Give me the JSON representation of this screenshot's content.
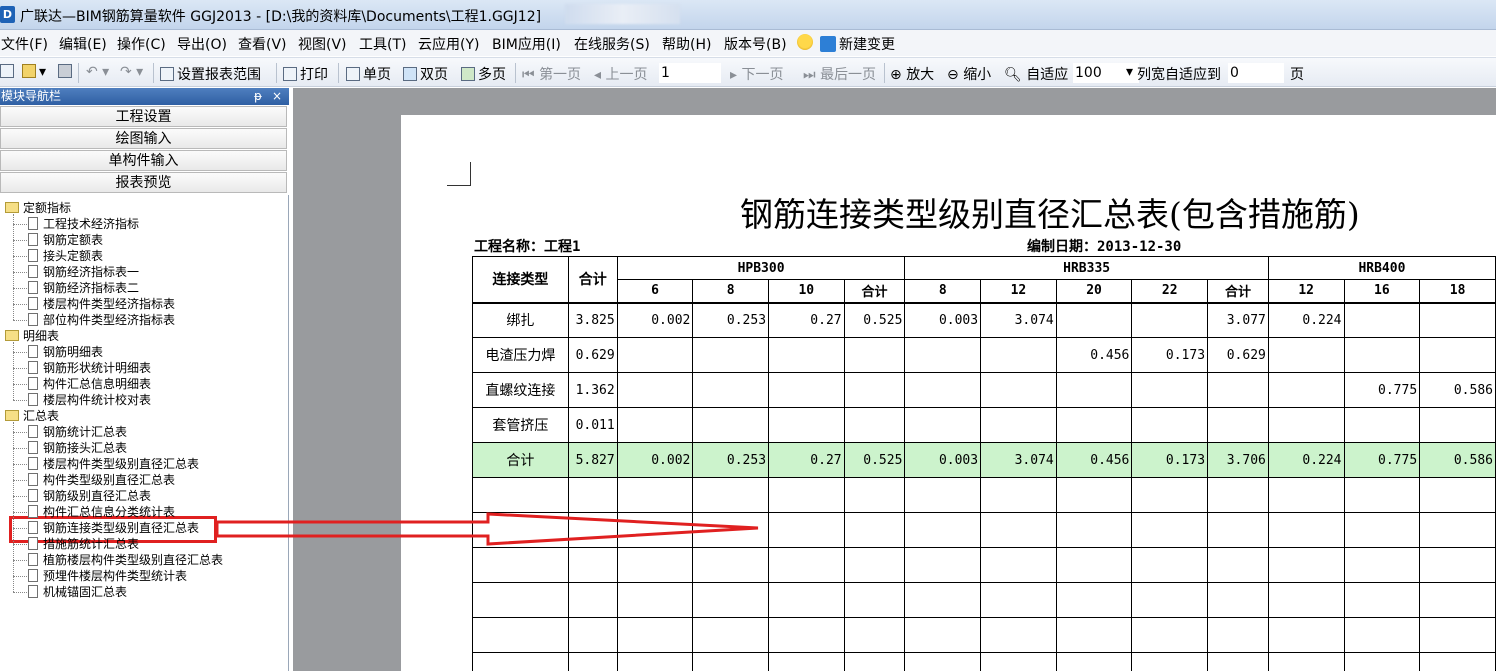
{
  "window": {
    "app_icon": "D",
    "title": "广联达—BIM钢筋算量软件 GGJ2013 - [D:\\我的资料库\\Documents\\工程1.GGJ12]"
  },
  "menu": {
    "items": [
      "文件(F)",
      "编辑(E)",
      "操作(C)",
      "导出(O)",
      "查看(V)",
      "视图(V)",
      "工具(T)",
      "云应用(Y)",
      "BIM应用(I)",
      "在线服务(S)",
      "帮助(H)",
      "版本号(B)"
    ],
    "new_change": "新建变更"
  },
  "toolbar": {
    "set_range": "设置报表范围",
    "print": "打印",
    "single_page": "单页",
    "double_page": "双页",
    "multi_page": "多页",
    "first_page": "第一页",
    "prev_page": "上一页",
    "page_value": "1",
    "next_page": "下一页",
    "last_page": "最后一页",
    "zoom_in": "放大",
    "zoom_out": "缩小",
    "fit": "自适应",
    "zoom_value": "100",
    "col_fit": "列宽自适应到",
    "col_fit_value": "0",
    "page_unit": "页"
  },
  "nav": {
    "header": "模块导航栏",
    "pin": "ᵽ",
    "close": "×",
    "tabs": [
      "工程设置",
      "绘图输入",
      "单构件输入",
      "报表预览"
    ],
    "groups": [
      {
        "label": "定额指标",
        "items": [
          "工程技术经济指标",
          "钢筋定额表",
          "接头定额表",
          "钢筋经济指标表一",
          "钢筋经济指标表二",
          "楼层构件类型经济指标表",
          "部位构件类型经济指标表"
        ]
      },
      {
        "label": "明细表",
        "items": [
          "钢筋明细表",
          "钢筋形状统计明细表",
          "构件汇总信息明细表",
          "楼层构件统计校对表"
        ]
      },
      {
        "label": "汇总表",
        "items": [
          "钢筋统计汇总表",
          "钢筋接头汇总表",
          "楼层构件类型级别直径汇总表",
          "构件类型级别直径汇总表",
          "钢筋级别直径汇总表",
          "构件汇总信息分类统计表",
          "钢筋连接类型级别直径汇总表",
          "措施筋统计汇总表",
          "植筋楼层构件类型级别直径汇总表",
          "预埋件楼层构件类型统计表",
          "机械锚固汇总表"
        ]
      }
    ]
  },
  "report": {
    "title": "钢筋连接类型级别直径汇总表(包含措施筋)",
    "project_name": "工程名称：工程1",
    "compile_date": "编制日期：2013-12-30",
    "header": {
      "type_col": "连接类型",
      "total_col": "合计",
      "groups": [
        {
          "name": "HPB300",
          "cols": [
            "6",
            "8",
            "10",
            "合计"
          ]
        },
        {
          "name": "HRB335",
          "cols": [
            "8",
            "12",
            "20",
            "22",
            "合计"
          ]
        },
        {
          "name": "HRB400",
          "cols": [
            "12",
            "16",
            "18"
          ]
        }
      ]
    },
    "rows": [
      {
        "label": "绑扎",
        "cells": [
          "3.825",
          "0.002",
          "0.253",
          "0.27",
          "0.525",
          "0.003",
          "3.074",
          "",
          "",
          "3.077",
          "0.224",
          "",
          ""
        ]
      },
      {
        "label": "电渣压力焊",
        "cells": [
          "0.629",
          "",
          "",
          "",
          "",
          "",
          "",
          "0.456",
          "0.173",
          "0.629",
          "",
          "",
          ""
        ]
      },
      {
        "label": "直螺纹连接",
        "cells": [
          "1.362",
          "",
          "",
          "",
          "",
          "",
          "",
          "",
          "",
          "",
          "",
          "0.775",
          "0.586"
        ]
      },
      {
        "label": "套管挤压",
        "cells": [
          "0.011",
          "",
          "",
          "",
          "",
          "",
          "",
          "",
          "",
          "",
          "",
          "",
          ""
        ]
      }
    ],
    "total_row": {
      "label": "合计",
      "cells": [
        "5.827",
        "0.002",
        "0.253",
        "0.27",
        "0.525",
        "0.003",
        "3.074",
        "0.456",
        "0.173",
        "3.706",
        "0.224",
        "0.775",
        "0.586"
      ]
    },
    "empty_rows": 6
  },
  "colors": {
    "highlight_red": "#e02020",
    "total_row_bg": "#ccf3cc",
    "preview_bg": "#999b9e"
  }
}
